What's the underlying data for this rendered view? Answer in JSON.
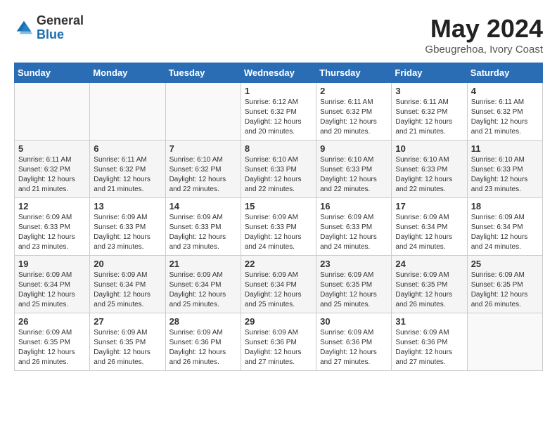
{
  "header": {
    "logo_general": "General",
    "logo_blue": "Blue",
    "month_year": "May 2024",
    "location": "Gbeugrehoa, Ivory Coast"
  },
  "weekdays": [
    "Sunday",
    "Monday",
    "Tuesday",
    "Wednesday",
    "Thursday",
    "Friday",
    "Saturday"
  ],
  "weeks": [
    [
      {
        "day": "",
        "info": ""
      },
      {
        "day": "",
        "info": ""
      },
      {
        "day": "",
        "info": ""
      },
      {
        "day": "1",
        "info": "Sunrise: 6:12 AM\nSunset: 6:32 PM\nDaylight: 12 hours\nand 20 minutes."
      },
      {
        "day": "2",
        "info": "Sunrise: 6:11 AM\nSunset: 6:32 PM\nDaylight: 12 hours\nand 20 minutes."
      },
      {
        "day": "3",
        "info": "Sunrise: 6:11 AM\nSunset: 6:32 PM\nDaylight: 12 hours\nand 21 minutes."
      },
      {
        "day": "4",
        "info": "Sunrise: 6:11 AM\nSunset: 6:32 PM\nDaylight: 12 hours\nand 21 minutes."
      }
    ],
    [
      {
        "day": "5",
        "info": "Sunrise: 6:11 AM\nSunset: 6:32 PM\nDaylight: 12 hours\nand 21 minutes."
      },
      {
        "day": "6",
        "info": "Sunrise: 6:11 AM\nSunset: 6:32 PM\nDaylight: 12 hours\nand 21 minutes."
      },
      {
        "day": "7",
        "info": "Sunrise: 6:10 AM\nSunset: 6:32 PM\nDaylight: 12 hours\nand 22 minutes."
      },
      {
        "day": "8",
        "info": "Sunrise: 6:10 AM\nSunset: 6:33 PM\nDaylight: 12 hours\nand 22 minutes."
      },
      {
        "day": "9",
        "info": "Sunrise: 6:10 AM\nSunset: 6:33 PM\nDaylight: 12 hours\nand 22 minutes."
      },
      {
        "day": "10",
        "info": "Sunrise: 6:10 AM\nSunset: 6:33 PM\nDaylight: 12 hours\nand 22 minutes."
      },
      {
        "day": "11",
        "info": "Sunrise: 6:10 AM\nSunset: 6:33 PM\nDaylight: 12 hours\nand 23 minutes."
      }
    ],
    [
      {
        "day": "12",
        "info": "Sunrise: 6:09 AM\nSunset: 6:33 PM\nDaylight: 12 hours\nand 23 minutes."
      },
      {
        "day": "13",
        "info": "Sunrise: 6:09 AM\nSunset: 6:33 PM\nDaylight: 12 hours\nand 23 minutes."
      },
      {
        "day": "14",
        "info": "Sunrise: 6:09 AM\nSunset: 6:33 PM\nDaylight: 12 hours\nand 23 minutes."
      },
      {
        "day": "15",
        "info": "Sunrise: 6:09 AM\nSunset: 6:33 PM\nDaylight: 12 hours\nand 24 minutes."
      },
      {
        "day": "16",
        "info": "Sunrise: 6:09 AM\nSunset: 6:33 PM\nDaylight: 12 hours\nand 24 minutes."
      },
      {
        "day": "17",
        "info": "Sunrise: 6:09 AM\nSunset: 6:34 PM\nDaylight: 12 hours\nand 24 minutes."
      },
      {
        "day": "18",
        "info": "Sunrise: 6:09 AM\nSunset: 6:34 PM\nDaylight: 12 hours\nand 24 minutes."
      }
    ],
    [
      {
        "day": "19",
        "info": "Sunrise: 6:09 AM\nSunset: 6:34 PM\nDaylight: 12 hours\nand 25 minutes."
      },
      {
        "day": "20",
        "info": "Sunrise: 6:09 AM\nSunset: 6:34 PM\nDaylight: 12 hours\nand 25 minutes."
      },
      {
        "day": "21",
        "info": "Sunrise: 6:09 AM\nSunset: 6:34 PM\nDaylight: 12 hours\nand 25 minutes."
      },
      {
        "day": "22",
        "info": "Sunrise: 6:09 AM\nSunset: 6:34 PM\nDaylight: 12 hours\nand 25 minutes."
      },
      {
        "day": "23",
        "info": "Sunrise: 6:09 AM\nSunset: 6:35 PM\nDaylight: 12 hours\nand 25 minutes."
      },
      {
        "day": "24",
        "info": "Sunrise: 6:09 AM\nSunset: 6:35 PM\nDaylight: 12 hours\nand 26 minutes."
      },
      {
        "day": "25",
        "info": "Sunrise: 6:09 AM\nSunset: 6:35 PM\nDaylight: 12 hours\nand 26 minutes."
      }
    ],
    [
      {
        "day": "26",
        "info": "Sunrise: 6:09 AM\nSunset: 6:35 PM\nDaylight: 12 hours\nand 26 minutes."
      },
      {
        "day": "27",
        "info": "Sunrise: 6:09 AM\nSunset: 6:35 PM\nDaylight: 12 hours\nand 26 minutes."
      },
      {
        "day": "28",
        "info": "Sunrise: 6:09 AM\nSunset: 6:36 PM\nDaylight: 12 hours\nand 26 minutes."
      },
      {
        "day": "29",
        "info": "Sunrise: 6:09 AM\nSunset: 6:36 PM\nDaylight: 12 hours\nand 27 minutes."
      },
      {
        "day": "30",
        "info": "Sunrise: 6:09 AM\nSunset: 6:36 PM\nDaylight: 12 hours\nand 27 minutes."
      },
      {
        "day": "31",
        "info": "Sunrise: 6:09 AM\nSunset: 6:36 PM\nDaylight: 12 hours\nand 27 minutes."
      },
      {
        "day": "",
        "info": ""
      }
    ]
  ]
}
